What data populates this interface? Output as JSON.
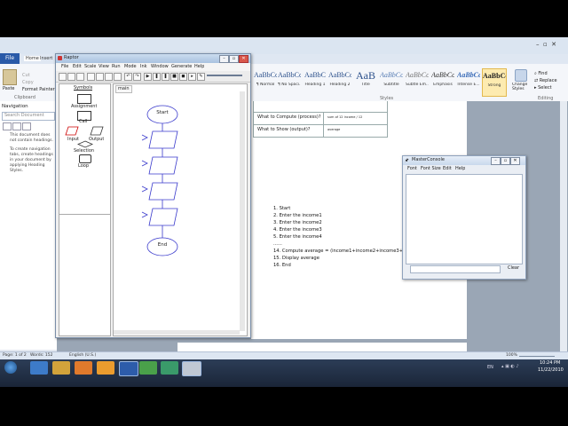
{
  "word": {
    "file_tab": "File",
    "tabs": [
      "Home",
      "Insert",
      "Page Layout",
      "References",
      "Mailings",
      "Review",
      "View"
    ],
    "clipboard": {
      "paste": "Paste",
      "cut": "Cut",
      "copy": "Copy",
      "format_painter": "Format Painter",
      "group_label": "Clipboard"
    },
    "styles": [
      {
        "sample": "AaBbCcI",
        "name": "¶ Normal"
      },
      {
        "sample": "AaBbCcI",
        "name": "¶ No Spaci..."
      },
      {
        "sample": "AaBbC",
        "name": "Heading 1"
      },
      {
        "sample": "AaBbCc",
        "name": "Heading 2"
      },
      {
        "sample": "AaB",
        "name": "Title"
      },
      {
        "sample": "AaBbCc.",
        "name": "Subtitle"
      },
      {
        "sample": "AaBbCcL",
        "name": "Subtle Em..."
      },
      {
        "sample": "AaBbCcL",
        "name": "Emphasis"
      },
      {
        "sample": "AaBbCcD",
        "name": "Intense E..."
      },
      {
        "sample": "AaBbCcE",
        "name": "Strong"
      }
    ],
    "styles_group_label": "Styles",
    "change_styles": "Change Styles",
    "editing": {
      "find": "Find",
      "replace": "Replace",
      "select": "Select",
      "group_label": "Editing"
    },
    "navigation": {
      "title": "Navigation",
      "search_placeholder": "Search Document",
      "message_1": "This document does not contain headings.",
      "message_2": "To create navigation tabs, create headings in your document by applying Heading Styles."
    },
    "table_rows": [
      {
        "label": "What to Compute (process)?",
        "value": "sum of 12 income / 12"
      },
      {
        "label": "What to Show (output)?",
        "value": "average"
      }
    ],
    "algorithm": [
      "1.   Start",
      "2.   Enter the income1",
      "3.   Enter the income2",
      "4.   Enter the income3",
      "5.   Enter the income4",
      "......",
      "14. Compute average = (income1+income2+income3+...",
      "15. Display average",
      "16. End"
    ],
    "status": {
      "page": "Page: 1 of 2",
      "words": "Words: 152",
      "language": "English (U.S.)",
      "zoom": "100%"
    }
  },
  "raptor": {
    "title": "Raptor",
    "menu": [
      "File",
      "Edit",
      "Scale",
      "View",
      "Run",
      "Mode",
      "Ink",
      "Window",
      "Generate",
      "Help"
    ],
    "symbols_label": "Symbols",
    "symbols": [
      "Assignment",
      "Call",
      "Input",
      "Output",
      "Selection",
      "Loop"
    ],
    "tab": "main",
    "flow": {
      "start": "Start",
      "end": "End"
    }
  },
  "console": {
    "title": "MasterConsole",
    "menu": [
      "Font",
      "Font Size",
      "Edit",
      "Help"
    ],
    "clear_label": "Clear"
  },
  "clock": {
    "time": "10:24 PM",
    "date": "11/22/2010",
    "lang": "EN"
  }
}
